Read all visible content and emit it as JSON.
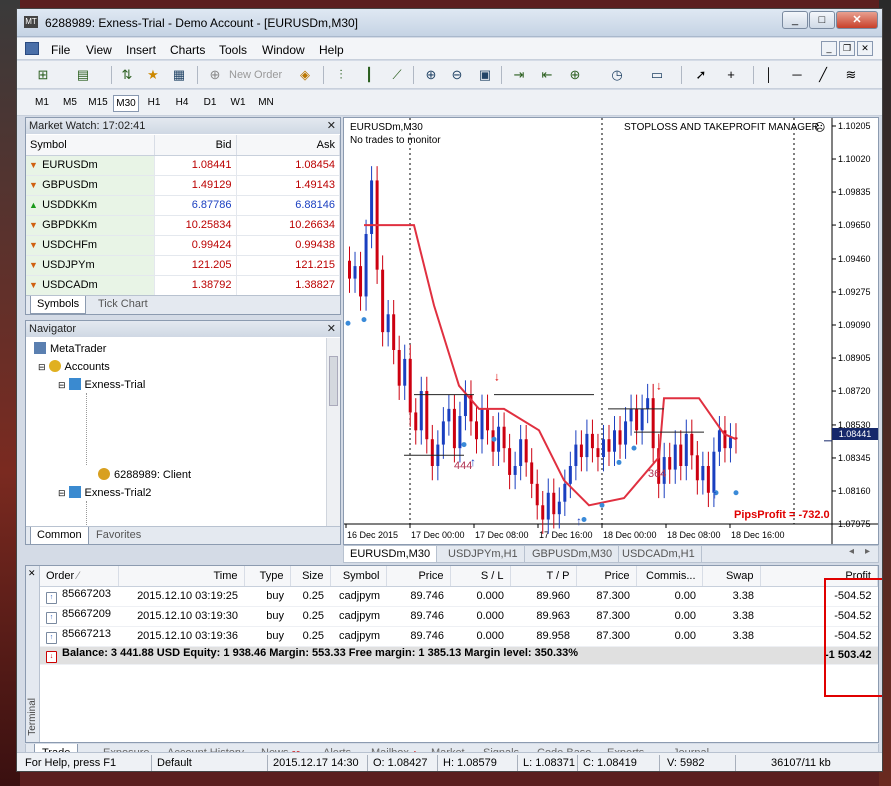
{
  "window": {
    "title": "6288989: Exness-Trial - Demo Account - [EURUSDm,M30]",
    "min": "_",
    "max": "□",
    "close": "✕"
  },
  "menu": [
    "File",
    "View",
    "Insert",
    "Charts",
    "Tools",
    "Window",
    "Help"
  ],
  "toolbar": {
    "new_order": "New Order"
  },
  "timeframes": [
    "M1",
    "M5",
    "M15",
    "M30",
    "H1",
    "H4",
    "D1",
    "W1",
    "MN"
  ],
  "market_watch": {
    "title": "Market Watch: 17:02:41",
    "headers": [
      "Symbol",
      "Bid",
      "Ask"
    ],
    "rows": [
      {
        "symbol": "EURUSDm",
        "bid": "1.08441",
        "ask": "1.08454",
        "dir": "down"
      },
      {
        "symbol": "GBPUSDm",
        "bid": "1.49129",
        "ask": "1.49143",
        "dir": "down"
      },
      {
        "symbol": "USDDKKm",
        "bid": "6.87786",
        "ask": "6.88146",
        "dir": "up"
      },
      {
        "symbol": "GBPDKKm",
        "bid": "10.25834",
        "ask": "10.26634",
        "dir": "down"
      },
      {
        "symbol": "USDCHFm",
        "bid": "0.99424",
        "ask": "0.99438",
        "dir": "down"
      },
      {
        "symbol": "USDJPYm",
        "bid": "121.205",
        "ask": "121.215",
        "dir": "down"
      },
      {
        "symbol": "USDCADm",
        "bid": "1.38792",
        "ask": "1.38827",
        "dir": "down"
      }
    ],
    "tabs": [
      "Symbols",
      "Tick Chart"
    ]
  },
  "navigator": {
    "title": "Navigator",
    "items": {
      "root": "MetaTrader",
      "accounts": "Accounts",
      "acc1": "Exness-Trial",
      "client": "6288989: Client",
      "acc2": "Exness-Trial2"
    },
    "tabs": [
      "Common",
      "Favorites"
    ]
  },
  "chart": {
    "symbol": "EURUSDm,M30",
    "status": "No trades to monitor",
    "manager": "STOPLOSS AND TAKEPROFIT MANAGER",
    "pips_profit": "PipsProfit = -732.0",
    "label_444": "444",
    "label_364": "364",
    "current_price": "1.08441",
    "yticks": [
      "1.10205",
      "1.10020",
      "1.09835",
      "1.09650",
      "1.09460",
      "1.09275",
      "1.09090",
      "1.08905",
      "1.08720",
      "1.08530",
      "1.08345",
      "1.08160",
      "1.07975"
    ],
    "xticks": [
      "16 Dec 2015",
      "17 Dec 00:00",
      "17 Dec 08:00",
      "17 Dec 16:00",
      "18 Dec 00:00",
      "18 Dec 08:00",
      "18 Dec 16:00"
    ],
    "tabs": [
      "EURUSDm,M30",
      "USDJPYm,H1",
      "GBPUSDm,M30",
      "USDCADm,H1"
    ]
  },
  "terminal": {
    "label": "Terminal",
    "headers": [
      "Order",
      "Time",
      "Type",
      "Size",
      "Symbol",
      "Price",
      "S / L",
      "T / P",
      "Price",
      "Commis...",
      "Swap",
      "Profit"
    ],
    "rows": [
      [
        "85667203",
        "2015.12.10 03:19:25",
        "buy",
        "0.25",
        "cadjpym",
        "89.746",
        "0.000",
        "89.960",
        "87.300",
        "0.00",
        "3.38",
        "-504.52"
      ],
      [
        "85667209",
        "2015.12.10 03:19:30",
        "buy",
        "0.25",
        "cadjpym",
        "89.746",
        "0.000",
        "89.963",
        "87.300",
        "0.00",
        "3.38",
        "-504.52"
      ],
      [
        "85667213",
        "2015.12.10 03:19:36",
        "buy",
        "0.25",
        "cadjpym",
        "89.746",
        "0.000",
        "89.958",
        "87.300",
        "0.00",
        "3.38",
        "-504.52"
      ]
    ],
    "balance": "Balance: 3 441.88 USD  Equity: 1 938.46  Margin: 553.33  Free margin: 1 385.13  Margin level: 350.33%",
    "balance_profit": "-1 503.42",
    "tabs": [
      {
        "label": "Trade",
        "badge": ""
      },
      {
        "label": "Exposure",
        "badge": ""
      },
      {
        "label": "Account History",
        "badge": ""
      },
      {
        "label": "News",
        "badge": "99"
      },
      {
        "label": "Alerts",
        "badge": ""
      },
      {
        "label": "Mailbox",
        "badge": "4"
      },
      {
        "label": "Market",
        "badge": ""
      },
      {
        "label": "Signals",
        "badge": ""
      },
      {
        "label": "Code Base",
        "badge": ""
      },
      {
        "label": "Experts",
        "badge": ""
      },
      {
        "label": "Journal",
        "badge": ""
      }
    ]
  },
  "status": {
    "help": "For Help, press F1",
    "profile": "Default",
    "time": "2015.12.17 14:30",
    "open": "O: 1.08427",
    "high": "H: 1.08579",
    "low": "L: 1.08371",
    "close": "C: 1.08419",
    "volume": "V: 5982",
    "traffic": "36107/11 kb"
  },
  "colors": {
    "accent_red": "#e00000",
    "bid_red": "#b00000",
    "candle_up": "#1a3fc0",
    "candle_down": "#cc0010",
    "ma": "#e03040"
  }
}
